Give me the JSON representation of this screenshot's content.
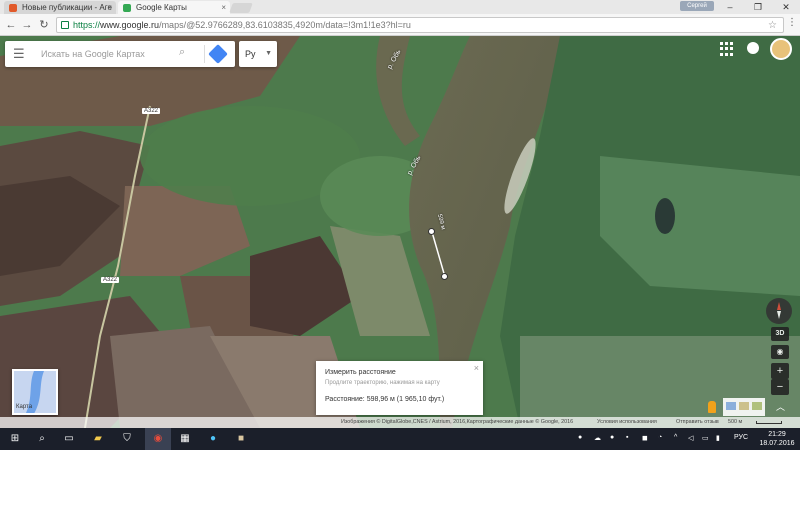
{
  "browser": {
    "tabs": [
      {
        "title": "Новые публикации - Аге",
        "active": false,
        "favicon_color": "#e15a2a"
      },
      {
        "title": "Google Карты",
        "active": true,
        "favicon_color": "#34a853"
      }
    ],
    "user_name": "Сергей",
    "url_scheme": "https://",
    "url_host": "www.google.ru",
    "url_path": "/maps/@52.9766289,83.6103835,4920m/data=!3m1!1e3?hl=ru"
  },
  "maps": {
    "search_placeholder": "Искать на Google Картах",
    "language_label": "Ру",
    "road_labels": [
      "А322",
      "А322"
    ],
    "river_labels": [
      "р. Обь",
      "р. Обь"
    ],
    "measure_point_label": "599 м",
    "measure_card": {
      "title": "Измерить расстояние",
      "hint": "Продлите траекторию, нажимая на карту",
      "distance": "Расстояние: 598,96 м (1 965,10 фут.)"
    },
    "minimap_label": "Карта",
    "control_3d": "3D",
    "attribution": {
      "imagery": "Изображения © DigitalGlobe,CNES / Astrium, 2016,Картографические данные © Google, 2016",
      "terms": "Условия использования",
      "feedback": "Отправить отзыв",
      "scale": "500 м"
    }
  },
  "taskbar": {
    "language": "РУС",
    "time": "21:29",
    "date": "18.07.2016"
  }
}
